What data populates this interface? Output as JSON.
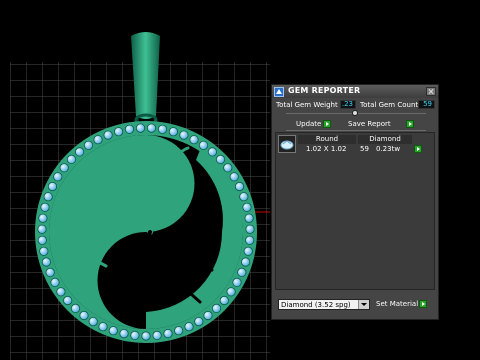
{
  "viewport": {
    "name": "3d-viewport"
  },
  "panel": {
    "title": "GEM REPORTER",
    "total_weight_label": "Total Gem Weight",
    "total_weight_value": ".23",
    "total_count_label": "Total Gem Count",
    "total_count_value": "59",
    "update_label": "Update",
    "save_report_label": "Save Report",
    "gems": [
      {
        "shape": "Round",
        "size": "1.02 X 1.02",
        "material": "Diamond",
        "count": "59",
        "weight": "0.23tw"
      }
    ],
    "material_select_value": "Diamond   (3.52 spg)",
    "set_material_label": "Set Material"
  },
  "colors": {
    "pendant": "#2fa37c",
    "pendant_dark": "#0b5a45",
    "gem": "#8ed8ff",
    "grid": "#5a5a5a",
    "accent_value": "#35d4ff",
    "button_green": "#2aa12a"
  }
}
